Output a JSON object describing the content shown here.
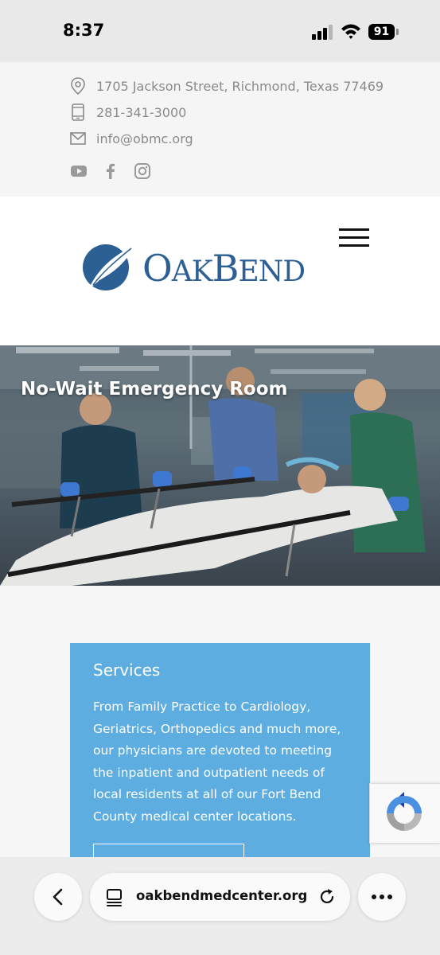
{
  "status_bar": {
    "time": "8:37",
    "battery": "91"
  },
  "contact": {
    "address": "1705 Jackson Street, Richmond, Texas 77469",
    "phone": "281-341-3000",
    "email": "info@obmc.org",
    "icons": [
      "location-pin-icon",
      "phone-icon",
      "mail-icon"
    ],
    "socials": [
      "youtube-icon",
      "facebook-icon",
      "instagram-icon"
    ]
  },
  "header": {
    "logo_text_big1": "O",
    "logo_text_small1": "AK",
    "logo_text_big2": "B",
    "logo_text_small2": "END",
    "menu_icon": "hamburger-menu-icon"
  },
  "hero": {
    "title": "No-Wait Emergency Room"
  },
  "services": {
    "title": "Services",
    "body": "From Family Practice to Cardiology, Geriatrics, Orthopedics and much more, our physicians are devoted to meeting the inpatient and outpatient needs of local residents at all of our Fort Bend County medical center locations."
  },
  "browser": {
    "url": "oakbendmedcenter.org",
    "back_icon": "chevron-left-icon",
    "reload_icon": "reload-icon",
    "more_icon": "ellipsis-icon"
  },
  "colors": {
    "brand_blue": "#2c5f93",
    "services_blue": "#5dade1",
    "contact_gray": "#8a8a8a"
  }
}
